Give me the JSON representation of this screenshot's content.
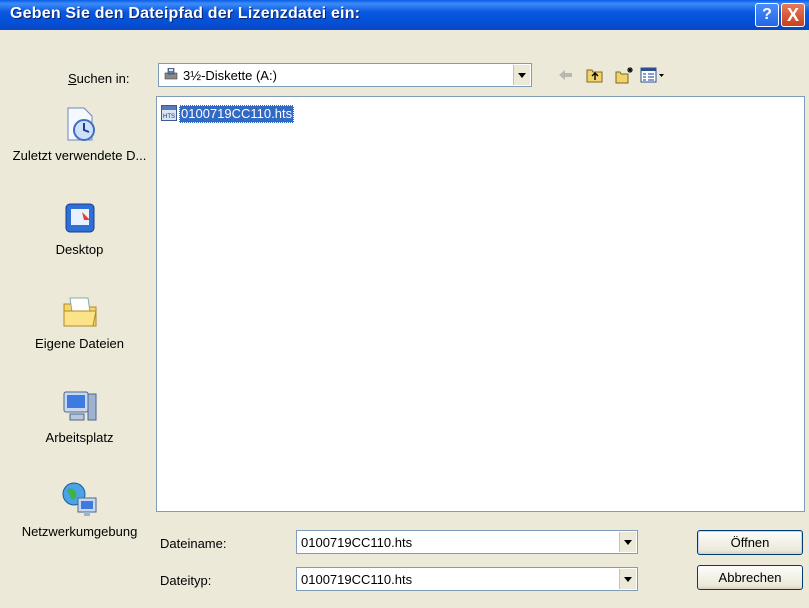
{
  "window": {
    "title": "Geben Sie den Dateipfad der Lizenzdatei ein:",
    "help_icon": "?",
    "close_icon": "X"
  },
  "lookin": {
    "label_prefix": "S",
    "label_rest": "uchen in:",
    "value": "3½-Diskette (A:)",
    "icon": "floppy-drive-icon"
  },
  "toolbar": {
    "icons": [
      "back-arrow-icon",
      "up-folder-icon",
      "new-folder-icon",
      "view-menu-icon"
    ]
  },
  "places": [
    {
      "label": "Zuletzt verwendete D...",
      "icon": "recent-documents-icon"
    },
    {
      "label": "Desktop",
      "icon": "desktop-icon"
    },
    {
      "label": "Eigene Dateien",
      "icon": "my-documents-icon"
    },
    {
      "label": "Arbeitsplatz",
      "icon": "my-computer-icon"
    },
    {
      "label": "Netzwerkumgebung",
      "icon": "network-places-icon"
    }
  ],
  "files": [
    {
      "name": "0100719CC110.hts",
      "icon_label": "HTS",
      "selected": true
    }
  ],
  "filename": {
    "label": "Dateiname:",
    "value": "0100719CC110.hts"
  },
  "filetype": {
    "label": "Dateityp:",
    "value": "0100719CC110.hts"
  },
  "buttons": {
    "open": "Öffnen",
    "cancel": "Abbrechen"
  },
  "colors": {
    "titlebar": "#0a58e0",
    "selection": "#316ac5",
    "dialog_bg": "#ece9d8"
  }
}
